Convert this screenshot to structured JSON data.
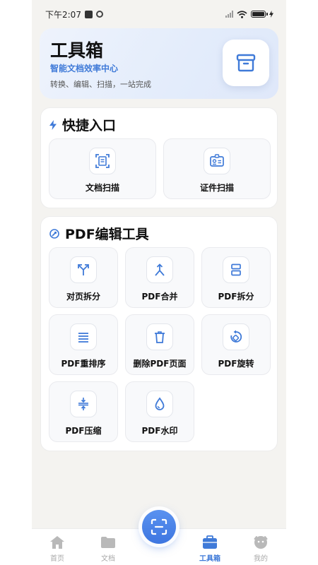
{
  "status_bar": {
    "time": "下午2:07"
  },
  "header": {
    "title": "工具箱",
    "subtitle": "智能文档效率中心",
    "description": "转换、编辑、扫描，一站完成"
  },
  "quick_access": {
    "title": "快捷入口",
    "items": [
      {
        "label": "文档扫描",
        "icon": "document-scan-icon"
      },
      {
        "label": "证件扫描",
        "icon": "id-card-icon"
      }
    ]
  },
  "pdf_tools": {
    "title": "PDF编辑工具",
    "items": [
      {
        "label": "对页拆分",
        "icon": "split-arrows-icon"
      },
      {
        "label": "PDF合并",
        "icon": "merge-arrows-icon"
      },
      {
        "label": "PDF拆分",
        "icon": "split-pages-icon"
      },
      {
        "label": "PDF重排序",
        "icon": "reorder-lines-icon"
      },
      {
        "label": "删除PDF页面",
        "icon": "trash-icon"
      },
      {
        "label": "PDF旋转",
        "icon": "rotate-icon"
      },
      {
        "label": "PDF压缩",
        "icon": "compress-icon"
      },
      {
        "label": "PDF水印",
        "icon": "watermark-drop-icon"
      }
    ]
  },
  "bottom_nav": {
    "items": [
      {
        "label": "首页",
        "icon": "home-icon"
      },
      {
        "label": "文档",
        "icon": "folder-icon"
      },
      {
        "label": "工具箱",
        "icon": "toolbox-icon",
        "active": true
      },
      {
        "label": "我的",
        "icon": "profile-icon"
      }
    ]
  },
  "colors": {
    "accent": "#3f7ad8",
    "background": "#f4f3f0"
  }
}
